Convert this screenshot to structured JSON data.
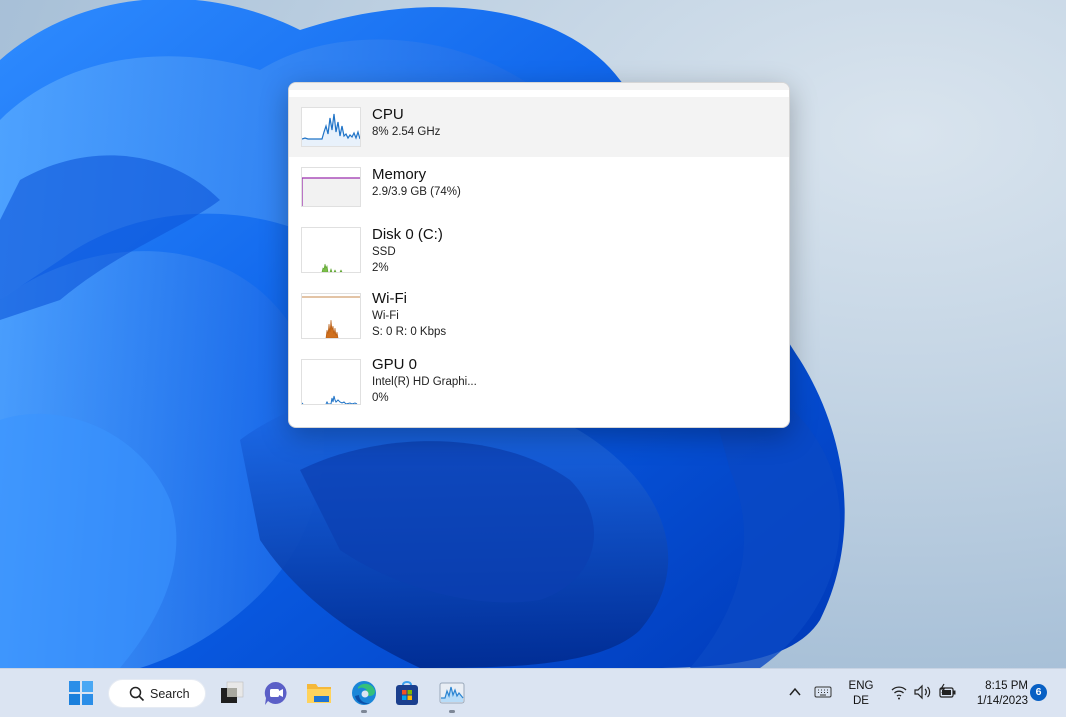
{
  "popup": {
    "items": [
      {
        "name": "CPU",
        "line1": "8% 2.54 GHz",
        "line2": "",
        "color": "#1f73c7",
        "selected": true
      },
      {
        "name": "Memory",
        "line1": "2.9/3.9 GB (74%)",
        "line2": "",
        "color": "#9b2fae",
        "usage_percent": 74
      },
      {
        "name": "Disk 0 (C:)",
        "line1": "SSD",
        "line2": "2%",
        "color": "#5aa02c"
      },
      {
        "name": "Wi-Fi",
        "line1": "Wi-Fi",
        "line2": "S: 0 R: 0 Kbps",
        "color": "#c8651a"
      },
      {
        "name": "GPU 0",
        "line1": "Intel(R) HD Graphi...",
        "line2": "0%",
        "color": "#1f73c7"
      }
    ]
  },
  "taskbar": {
    "search_label": "Search",
    "apps": [
      {
        "icon": "windows-start-icon"
      },
      {
        "icon": "task-view-icon"
      },
      {
        "icon": "teams-chat-icon"
      },
      {
        "icon": "file-explorer-icon"
      },
      {
        "icon": "edge-browser-icon",
        "running": true
      },
      {
        "icon": "microsoft-store-icon"
      },
      {
        "icon": "task-manager-icon",
        "running": true
      }
    ],
    "tray": {
      "language_top": "ENG",
      "language_bottom": "DE",
      "time": "8:15 PM",
      "date": "1/14/2023",
      "notification_count": "6"
    }
  }
}
